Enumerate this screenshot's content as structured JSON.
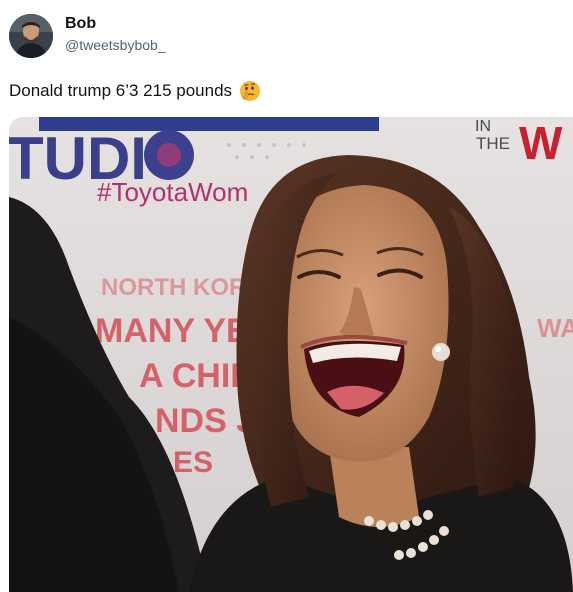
{
  "author": {
    "display_name": "Bob",
    "handle": "@tweetsbybob_"
  },
  "tweet": {
    "text": "Donald trump 6’3 215 pounds",
    "emoji_icon": "thinking-face-icon"
  },
  "media": {
    "backdrop_text": {
      "studio": "TUDIO",
      "hashtag": "#ToyotaWom",
      "in_the": "IN\nTHE",
      "w": "W",
      "north_kor": "NORTH KOR",
      "many_yemen": "MANY YEME",
      "chile": "A CHILE",
      "nds_jo": "NDS JO",
      "es": "ES",
      "wa": "WA"
    }
  },
  "colors": {
    "text_primary": "#0f1419",
    "text_secondary": "#536471",
    "backdrop_blue": "#2d3e8f",
    "backdrop_red": "#c8202f"
  }
}
